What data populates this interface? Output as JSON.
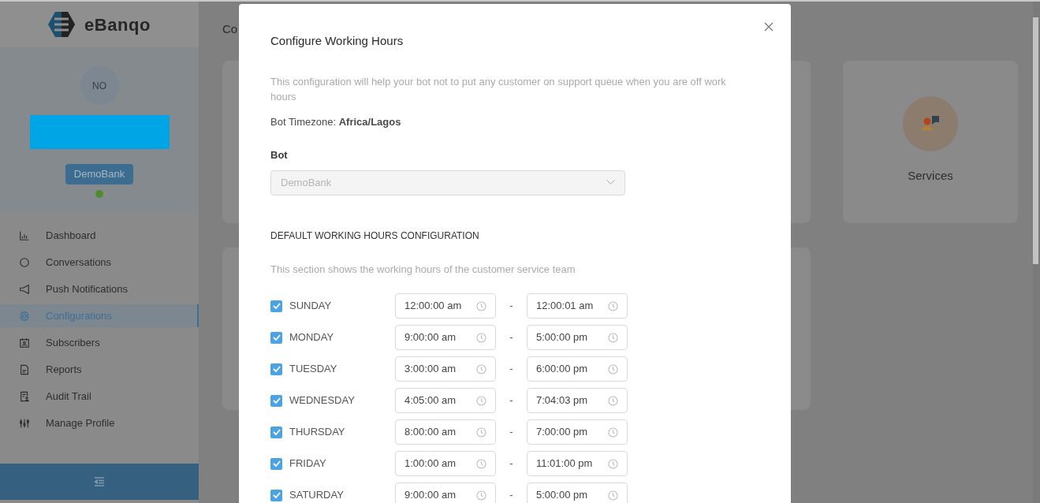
{
  "sidebar": {
    "logo": "eBanqo",
    "avatar": "NO",
    "bot_badge": "DemoBank",
    "items": [
      {
        "label": "Dashboard",
        "selected": false
      },
      {
        "label": "Conversations",
        "selected": false
      },
      {
        "label": "Push Notifications",
        "selected": false
      },
      {
        "label": "Configurations",
        "selected": true
      },
      {
        "label": "Subscribers",
        "selected": false
      },
      {
        "label": "Reports",
        "selected": false
      },
      {
        "label": "Audit Trail",
        "selected": false
      },
      {
        "label": "Manage Profile",
        "selected": false
      }
    ]
  },
  "page": {
    "title": "Co",
    "cards": [
      {
        "label": "Services"
      }
    ]
  },
  "modal": {
    "title": "Configure Working Hours",
    "description": "This configuration will help your bot not to put any customer on support queue when you are off work hours",
    "timezone": "Bot Timezone: **Africa/Lagos**",
    "bot_field": {
      "label": "Bot",
      "value": "DemoBank",
      "disabled": true
    },
    "section_title": "DEFAULT WORKING HOURS CONFIGURATION",
    "section_description": "This section shows the working hours of the customer service team",
    "separator": "-",
    "days": [
      {
        "label": "SUNDAY",
        "checked": true,
        "start": "12:00:00 am",
        "end": "12:00:01 am"
      },
      {
        "label": "MONDAY",
        "checked": true,
        "start": "9:00:00 am",
        "end": "5:00:00 pm"
      },
      {
        "label": "TUESDAY",
        "checked": true,
        "start": "3:00:00 am",
        "end": "6:00:00 pm"
      },
      {
        "label": "WEDNESDAY",
        "checked": true,
        "start": "4:05:00 am",
        "end": "7:04:03 pm"
      },
      {
        "label": "THURSDAY",
        "checked": true,
        "start": "8:00:00 am",
        "end": "7:00:00 pm"
      },
      {
        "label": "FRIDAY",
        "checked": true,
        "start": "1:00:00 am",
        "end": "11:01:00 pm"
      },
      {
        "label": "SATURDAY",
        "checked": true,
        "start": "9:00:00 am",
        "end": "5:00:00 pm"
      }
    ]
  }
}
